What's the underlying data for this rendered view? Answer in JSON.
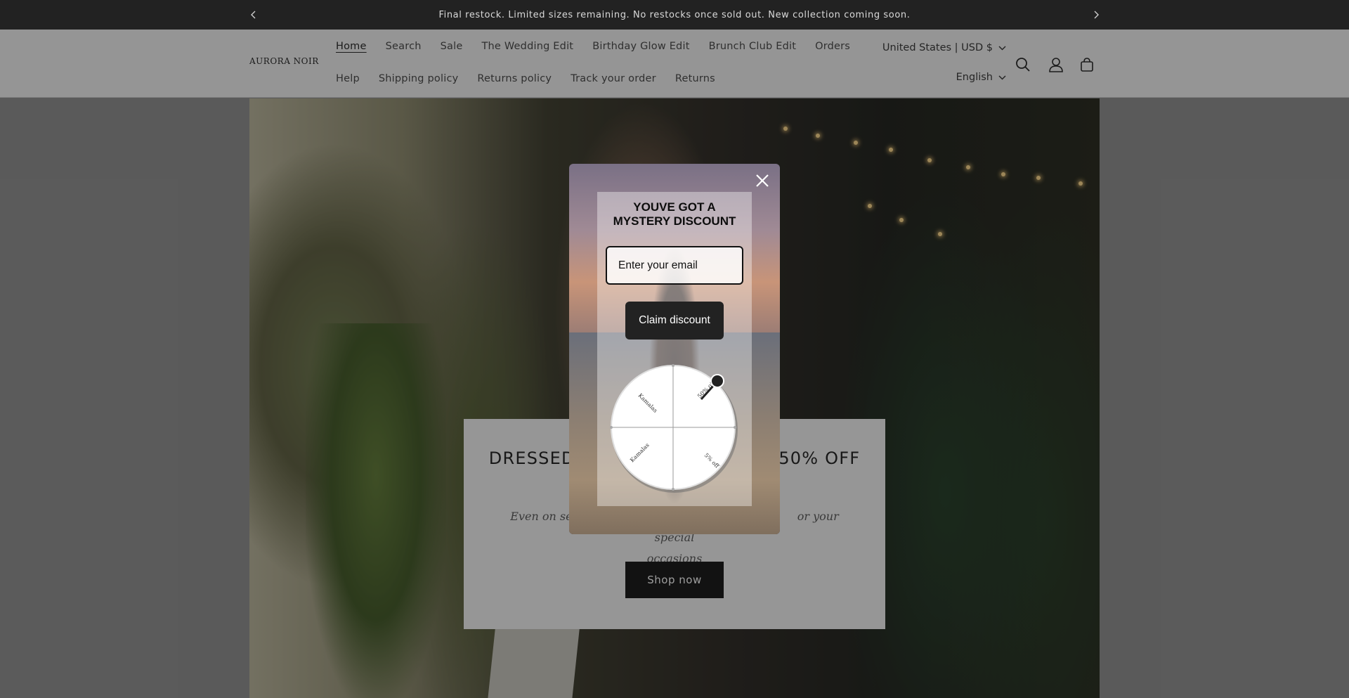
{
  "announcement": {
    "text": "Final restock. Limited sizes remaining. No restocks once sold out. New collection coming soon.",
    "prev_icon": "chevron-left-icon",
    "next_icon": "chevron-right-icon"
  },
  "header": {
    "logo": "AURORA NOIR",
    "nav_row_1": [
      "Home",
      "Search",
      "Sale",
      "The Wedding Edit",
      "Birthday Glow Edit",
      "Brunch Club Edit",
      "Orders"
    ],
    "nav_row_2": [
      "Help",
      "Shipping policy",
      "Returns policy",
      "Track your order",
      "Returns"
    ],
    "country_selector": "United States | USD $",
    "language_selector": "English",
    "icons": [
      "search-icon",
      "account-icon",
      "cart-icon"
    ]
  },
  "hero": {
    "title_left": "DRESSED",
    "title_right": "50% OFF",
    "subtitle_left": "Even on select",
    "subtitle_right": "or your special",
    "subtitle_line2": "occasions",
    "button": "Shop now"
  },
  "popup": {
    "headline_line1": "YOUVE GOT A",
    "headline_line2": "MYSTERY DISCOUNT",
    "email_placeholder": "Enter your email",
    "claim_button": "Claim discount",
    "wheel_labels": [
      "Kamalas",
      "50% off",
      "Kamalas",
      "5% off"
    ],
    "close_icon": "close-icon"
  },
  "colors": {
    "announcement_bg": "#222222",
    "button_bg": "#121212",
    "overlay": "rgba(20,20,20,0.42)"
  }
}
